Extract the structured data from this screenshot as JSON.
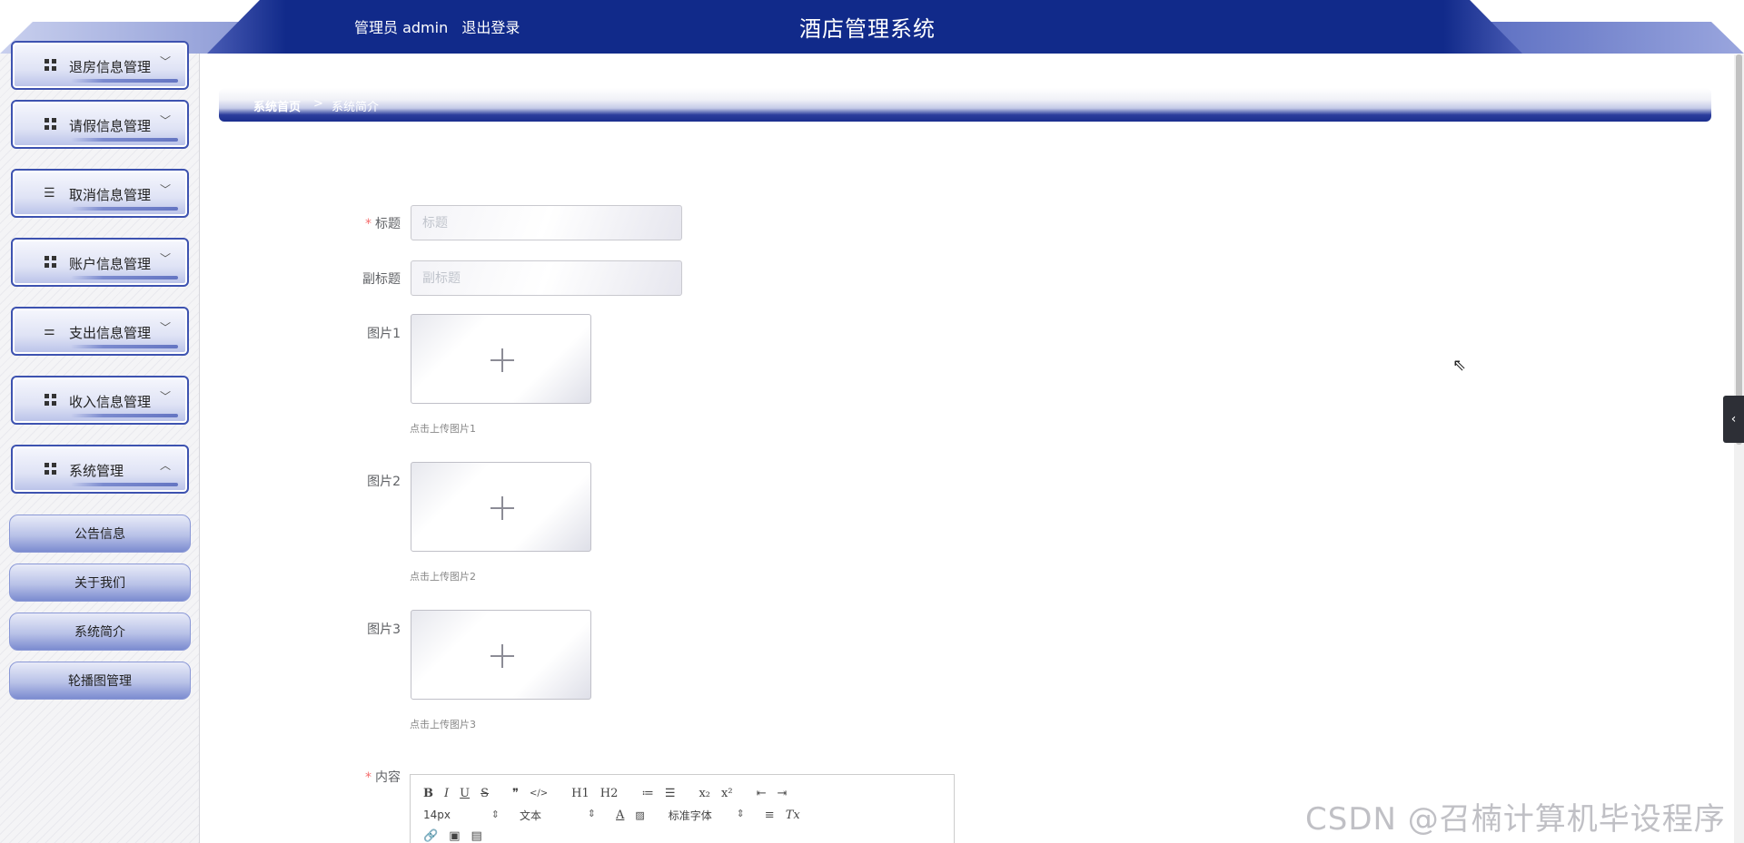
{
  "header": {
    "role_label": "管理员 admin",
    "logout_label": "退出登录",
    "app_title": "酒店管理系统"
  },
  "sidebar": {
    "menus": [
      {
        "label": "退房信息管理",
        "icon": "grid-icon",
        "expanded": false
      },
      {
        "label": "请假信息管理",
        "icon": "grid-icon",
        "expanded": false
      },
      {
        "label": "取消信息管理",
        "icon": "list-icon",
        "expanded": false
      },
      {
        "label": "账户信息管理",
        "icon": "grid-icon",
        "expanded": false
      },
      {
        "label": "支出信息管理",
        "icon": "sliders-icon",
        "expanded": false
      },
      {
        "label": "收入信息管理",
        "icon": "grid-icon",
        "expanded": false
      },
      {
        "label": "系统管理",
        "icon": "grid-icon",
        "expanded": true
      }
    ],
    "submenu": [
      {
        "label": "公告信息"
      },
      {
        "label": "关于我们"
      },
      {
        "label": "系统简介"
      },
      {
        "label": "轮播图管理"
      }
    ]
  },
  "breadcrumb": {
    "home": "系统首页",
    "separator": ">",
    "current": "系统简介"
  },
  "form": {
    "title": {
      "label": "标题",
      "required": true,
      "placeholder": "标题",
      "value": ""
    },
    "subtitle": {
      "label": "副标题",
      "required": false,
      "placeholder": "副标题",
      "value": ""
    },
    "images": [
      {
        "label": "图片1",
        "hint": "点击上传图片1"
      },
      {
        "label": "图片2",
        "hint": "点击上传图片2"
      },
      {
        "label": "图片3",
        "hint": "点击上传图片3"
      }
    ],
    "content": {
      "label": "内容",
      "required": true
    }
  },
  "editor": {
    "toolbar_row1": [
      "B",
      "I",
      "U",
      "S",
      "❞",
      "</>",
      "H1",
      "H2",
      "≔",
      "☰",
      "x₂",
      "x²",
      "⇤",
      "⇥"
    ],
    "font_size": "14px",
    "text_style": "文本",
    "font_family": "标准字体"
  },
  "watermark": "CSDN @召楠计算机毕设程序"
}
